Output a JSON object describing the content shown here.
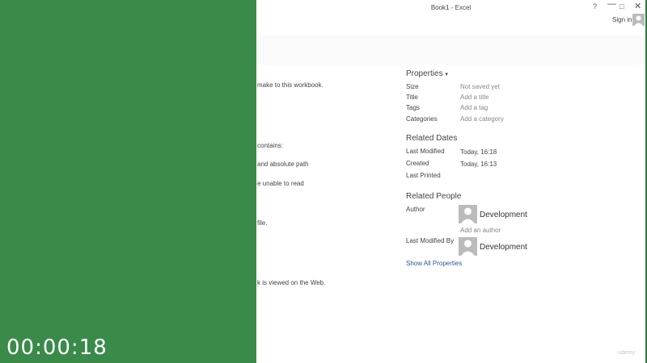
{
  "overlay": {
    "timer": "00:00:18"
  },
  "window": {
    "title": "Book1 - Excel",
    "help": "?",
    "minimize": "—",
    "maximize": "□",
    "close": "✕",
    "sign_in": "Sign in"
  },
  "left_fragments": [
    "make to this workbook.",
    "contains:",
    "and absolute path",
    "e unable to read",
    "file.",
    "k is viewed on the Web."
  ],
  "properties": {
    "heading": "Properties",
    "dropdown_icon": "▾",
    "rows": [
      {
        "label": "Size",
        "value": "Not saved yet"
      },
      {
        "label": "Title",
        "value": "Add a title"
      },
      {
        "label": "Tags",
        "value": "Add a tag"
      },
      {
        "label": "Categories",
        "value": "Add a category"
      }
    ]
  },
  "related_dates": {
    "heading": "Related Dates",
    "rows": [
      {
        "label": "Last Modified",
        "value": "Today, 16:18"
      },
      {
        "label": "Created",
        "value": "Today, 16:13"
      },
      {
        "label": "Last Printed",
        "value": ""
      }
    ]
  },
  "related_people": {
    "heading": "Related People",
    "author_label": "Author",
    "author_name": "Development",
    "add_author": "Add an author",
    "last_modified_by_label": "Last Modified By",
    "last_modified_by_name": "Development",
    "show_all": "Show All Properties"
  },
  "watermark": "udemy"
}
